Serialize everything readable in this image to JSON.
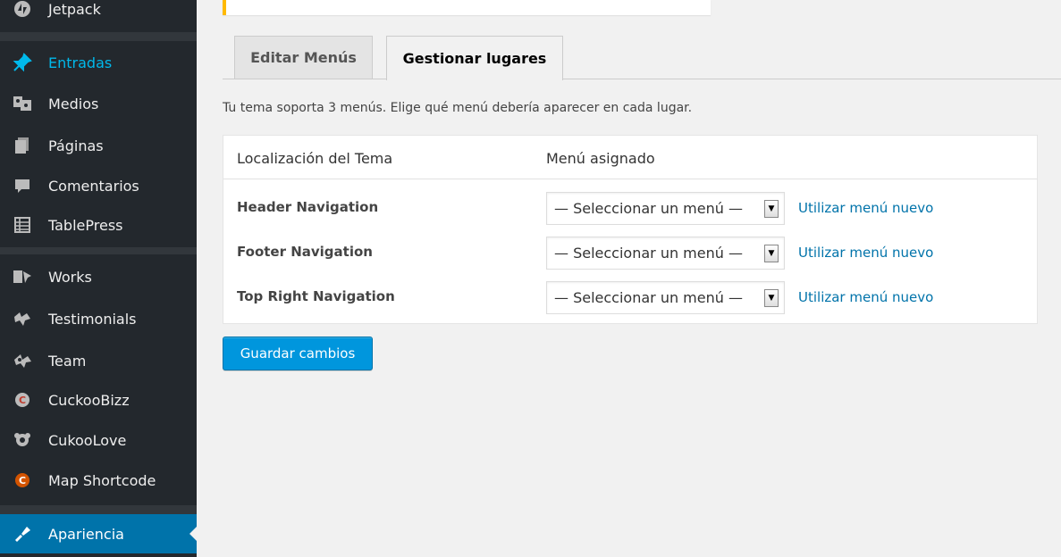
{
  "sidebar": {
    "items": [
      {
        "label": "Jetpack",
        "icon": "jetpack-icon"
      },
      {
        "label": "Entradas",
        "icon": "pin-icon"
      },
      {
        "label": "Medios",
        "icon": "media-icon"
      },
      {
        "label": "Páginas",
        "icon": "pages-icon"
      },
      {
        "label": "Comentarios",
        "icon": "comments-icon"
      },
      {
        "label": "TablePress",
        "icon": "table-icon"
      },
      {
        "label": "Works",
        "icon": "works-icon"
      },
      {
        "label": "Testimonials",
        "icon": "testimonials-icon"
      },
      {
        "label": "Team",
        "icon": "team-icon"
      },
      {
        "label": "CuckooBizz",
        "icon": "cuckoobizz-icon"
      },
      {
        "label": "CukooLove",
        "icon": "cukoolove-icon"
      },
      {
        "label": "Map Shortcode",
        "icon": "map-shortcode-icon"
      },
      {
        "label": "Apariencia",
        "icon": "appearance-icon"
      }
    ]
  },
  "tabs": {
    "edit": "Editar Menús",
    "manage": "Gestionar lugares"
  },
  "description": "Tu tema soporta 3 menús. Elige qué menú debería aparecer en cada lugar.",
  "table": {
    "col_location": "Localización del Tema",
    "col_menu": "Menú asignado",
    "rows": [
      {
        "location": "Header Navigation",
        "select": "— Seleccionar un menú —",
        "link": "Utilizar menú nuevo"
      },
      {
        "location": "Footer Navigation",
        "select": "— Seleccionar un menú —",
        "link": "Utilizar menú nuevo"
      },
      {
        "location": "Top Right Navigation",
        "select": "— Seleccionar un menú —",
        "link": "Utilizar menú nuevo"
      }
    ]
  },
  "save_label": "Guardar cambios",
  "colors": {
    "sidebar_bg": "#23282d",
    "accent": "#0073aa",
    "button": "#0096dd",
    "notice": "#ffb900"
  }
}
